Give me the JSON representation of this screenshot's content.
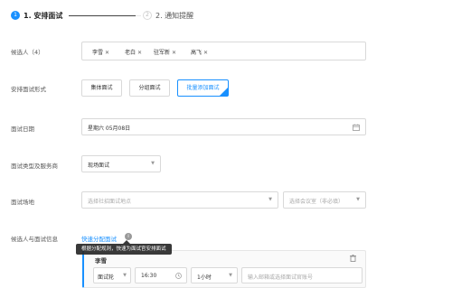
{
  "stepper": {
    "step1_num": "1",
    "step1_title": "1. 安排面试",
    "step2_num": "2",
    "step2_title": "2. 通知提醒"
  },
  "candidates": {
    "label": "候选人（4）",
    "tags": [
      "李雪",
      "老白",
      "驻军新",
      "高飞"
    ]
  },
  "interview_form": {
    "label": "安排面试形式",
    "options": [
      "集体面试",
      "分组面试",
      "批量添加面试"
    ],
    "selected": "批量添加面试"
  },
  "interview_date": {
    "label": "面试日期",
    "value": "星期六 05月08日"
  },
  "interview_type": {
    "label": "面试类型及服务商",
    "value": "现场面试"
  },
  "venue": {
    "label": "面试场地",
    "site_placeholder": "选择社招面试地点",
    "room_placeholder": "选择会议室（非必填）"
  },
  "candidate_info": {
    "label": "候选人与面试信息",
    "quick_assign_link": "快速分配面试",
    "tooltip": "根据分配规则，快速为面试官安排面试"
  },
  "row": {
    "name": "李雪",
    "round": "面试轮",
    "time": "16:30",
    "duration": "1小时",
    "interviewer_placeholder": "输入邮箱或选择面试官账号"
  },
  "colors": {
    "accent": "#1890ff",
    "border": "#d9d9d9"
  },
  "icons": [
    "close-icon",
    "calendar-icon",
    "chevron-down-icon",
    "info-icon",
    "clock-icon",
    "trash-icon",
    "check-icon"
  ]
}
